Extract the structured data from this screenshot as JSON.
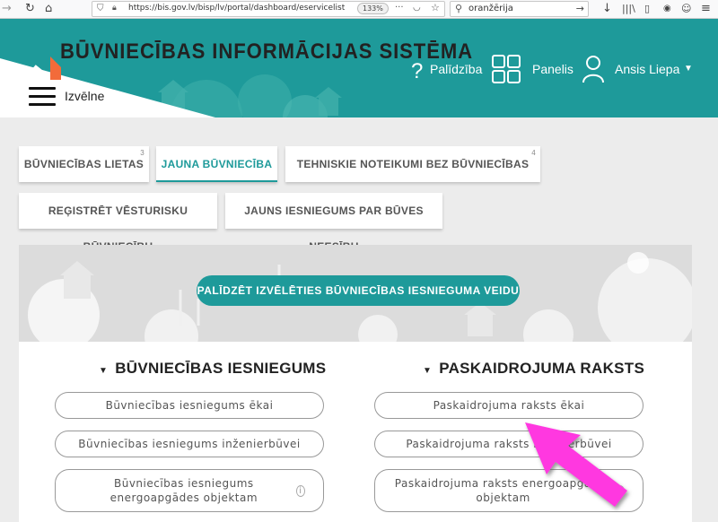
{
  "browser": {
    "url": "https://bis.gov.lv/bisp/lv/portal/dashboard/eservicelist",
    "zoom": "133%",
    "search_value": "oranžērija"
  },
  "header": {
    "title": "BŪVNIECĪBAS INFORMĀCIJAS SISTĒMA",
    "menu_label": "Izvēlne",
    "help_label": "Palīdzība",
    "panel_label": "Panelis",
    "user_name": "Ansis Liepa"
  },
  "tabs": [
    {
      "label": "BŪVNIECĪBAS LIETAS",
      "count": "3"
    },
    {
      "label": "JAUNA BŪVNIECĪBA",
      "count": ""
    },
    {
      "label": "TEHNISKIE NOTEIKUMI BEZ BŪVNIECĪBAS LIETĀM",
      "count": "4"
    },
    {
      "label": "REĢISTRĒT VĒSTURISKU BŪVNIECĪBU",
      "count": ""
    },
    {
      "label": "JAUNS IESNIEGUMS PAR BŪVES NEESĪBU",
      "count": ""
    }
  ],
  "active_tab": "JAUNA BŪVNIECĪBA",
  "panel": {
    "help_button": "PALĪDZĒT IZVĒLĒTIES BŪVNIECĪBAS IESNIEGUMA VEIDU",
    "left_section": {
      "title": "BŪVNIECĪBAS IESNIEGUMS",
      "items": [
        "Būvniecības iesniegums ēkai",
        "Būvniecības iesniegums inženierbūvei",
        "Būvniecības iesniegums energoapgādes objektam"
      ]
    },
    "right_section": {
      "title": "PASKAIDROJUMA RAKSTS",
      "items": [
        "Paskaidrojuma raksts ēkai",
        "Paskaidrojuma raksts inženierbūvei",
        "Paskaidrojuma raksts energoapgādes objektam"
      ]
    }
  },
  "colors": {
    "teal": "#1e9a9a",
    "arrow": "#ff38e0",
    "background": "#ececec"
  }
}
